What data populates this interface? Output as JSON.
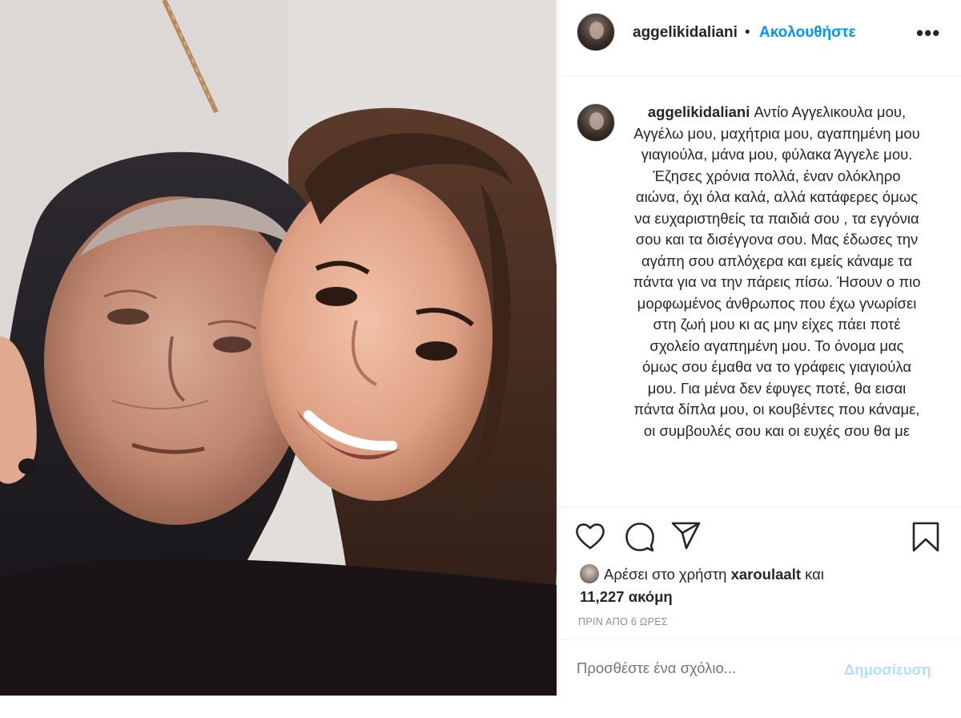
{
  "header": {
    "username": "aggelikidaliani",
    "separator": "•",
    "follow_label": "Ακολουθήστε",
    "more_icon": "more-options-icon"
  },
  "caption": {
    "username": "aggelikidaliani",
    "text": "Αντίο Αγγελικουλα μου, Αγγέλω μου, μαχήτρια μου, αγαπημένη μου γιαγιούλα, μάνα μου, φύλακα Άγγελε μου. Έζησες χρόνια πολλά, έναν ολόκληρο αιώνα, όχι όλα καλά, αλλά κατάφερες όμως να ευχαριστηθείς τα παιδιά σου , τα εγγόνια σου και τα δισέγγονα σου. Μας έδωσες την αγάπη σου απλόχερα και εμείς κάναμε τα πάντα για να την πάρεις πίσω. Ήσουν ο πιο μορφωμένος άνθρωπος που έχω γνωρίσει στη ζωή μου κι ας μην είχες πάει ποτέ σχολείο αγαπημένη μου. Το όνομα μας όμως σου έμαθα να το γράφεις γιαγιούλα μου. Για μένα δεν έφυγες ποτέ, θα εισαι πάντα δίπλα μου, οι κουβέντες που κάναμε, οι συμβουλές σου και οι ευχές σου θα με"
  },
  "actions": {
    "like_icon": "heart-icon",
    "comment_icon": "comment-icon",
    "share_icon": "paper-plane-icon",
    "save_icon": "bookmark-icon"
  },
  "likes": {
    "prefix": "Αρέσει στο χρήστη",
    "user": "xaroulaalt",
    "and": "και",
    "count_text": "11,227 ακόμη"
  },
  "timestamp": "ΠΡΙΝ ΑΠΟ 6 ΩΡΕΣ",
  "comment_box": {
    "placeholder": "Προσθέστε ένα σχόλιο...",
    "post_label": "Δημοσίευση"
  },
  "colors": {
    "link_blue": "#0095f6",
    "post_disabled": "#b2dffc",
    "muted": "#8e8e8e",
    "text": "#262626",
    "divider": "#efefef"
  }
}
